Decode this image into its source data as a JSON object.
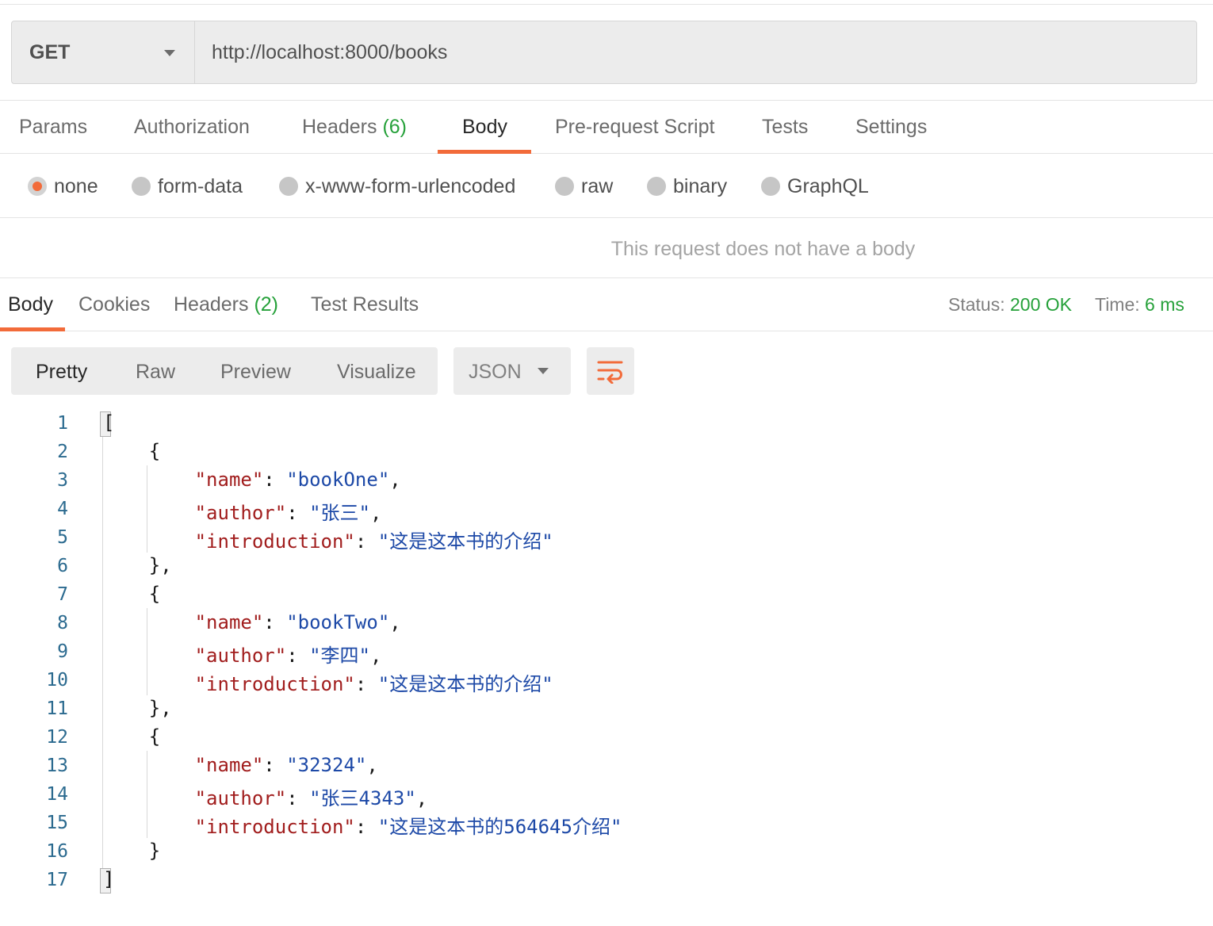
{
  "request": {
    "method": "GET",
    "url": "http://localhost:8000/books"
  },
  "request_tabs": [
    {
      "label": "Params",
      "count": ""
    },
    {
      "label": "Authorization",
      "count": ""
    },
    {
      "label": "Headers",
      "count": "(6)"
    },
    {
      "label": "Body",
      "count": ""
    },
    {
      "label": "Pre-request Script",
      "count": ""
    },
    {
      "label": "Tests",
      "count": ""
    },
    {
      "label": "Settings",
      "count": ""
    }
  ],
  "active_request_tab": "Body",
  "body_types": [
    "none",
    "form-data",
    "x-www-form-urlencoded",
    "raw",
    "binary",
    "GraphQL"
  ],
  "selected_body_type": "none",
  "no_body_message": "This request does not have a body",
  "response_tabs": [
    {
      "label": "Body",
      "count": ""
    },
    {
      "label": "Cookies",
      "count": ""
    },
    {
      "label": "Headers",
      "count": "(2)"
    },
    {
      "label": "Test Results",
      "count": ""
    }
  ],
  "active_response_tab": "Body",
  "response_meta": {
    "status_label": "Status:",
    "status_value": "200 OK",
    "time_label": "Time:",
    "time_value": "6 ms"
  },
  "view_modes": [
    "Pretty",
    "Raw",
    "Preview",
    "Visualize"
  ],
  "active_view_mode": "Pretty",
  "format": "JSON",
  "line_numbers": [
    "1",
    "2",
    "3",
    "4",
    "5",
    "6",
    "7",
    "8",
    "9",
    "10",
    "11",
    "12",
    "13",
    "14",
    "15",
    "16",
    "17"
  ],
  "books": [
    {
      "name": "bookOne",
      "author": "张三",
      "introduction": "这是这本书的介绍"
    },
    {
      "name": "bookTwo",
      "author": "李四",
      "introduction": "这是这本书的介绍"
    },
    {
      "name": "32324",
      "author": "张三4343",
      "introduction": "这是这本书的564645介绍"
    }
  ],
  "colors": {
    "accent": "#f26b3a",
    "success": "#26a13a",
    "json_key": "#a11d1d",
    "json_string": "#1d49a7",
    "line_number": "#2b6a8f"
  }
}
